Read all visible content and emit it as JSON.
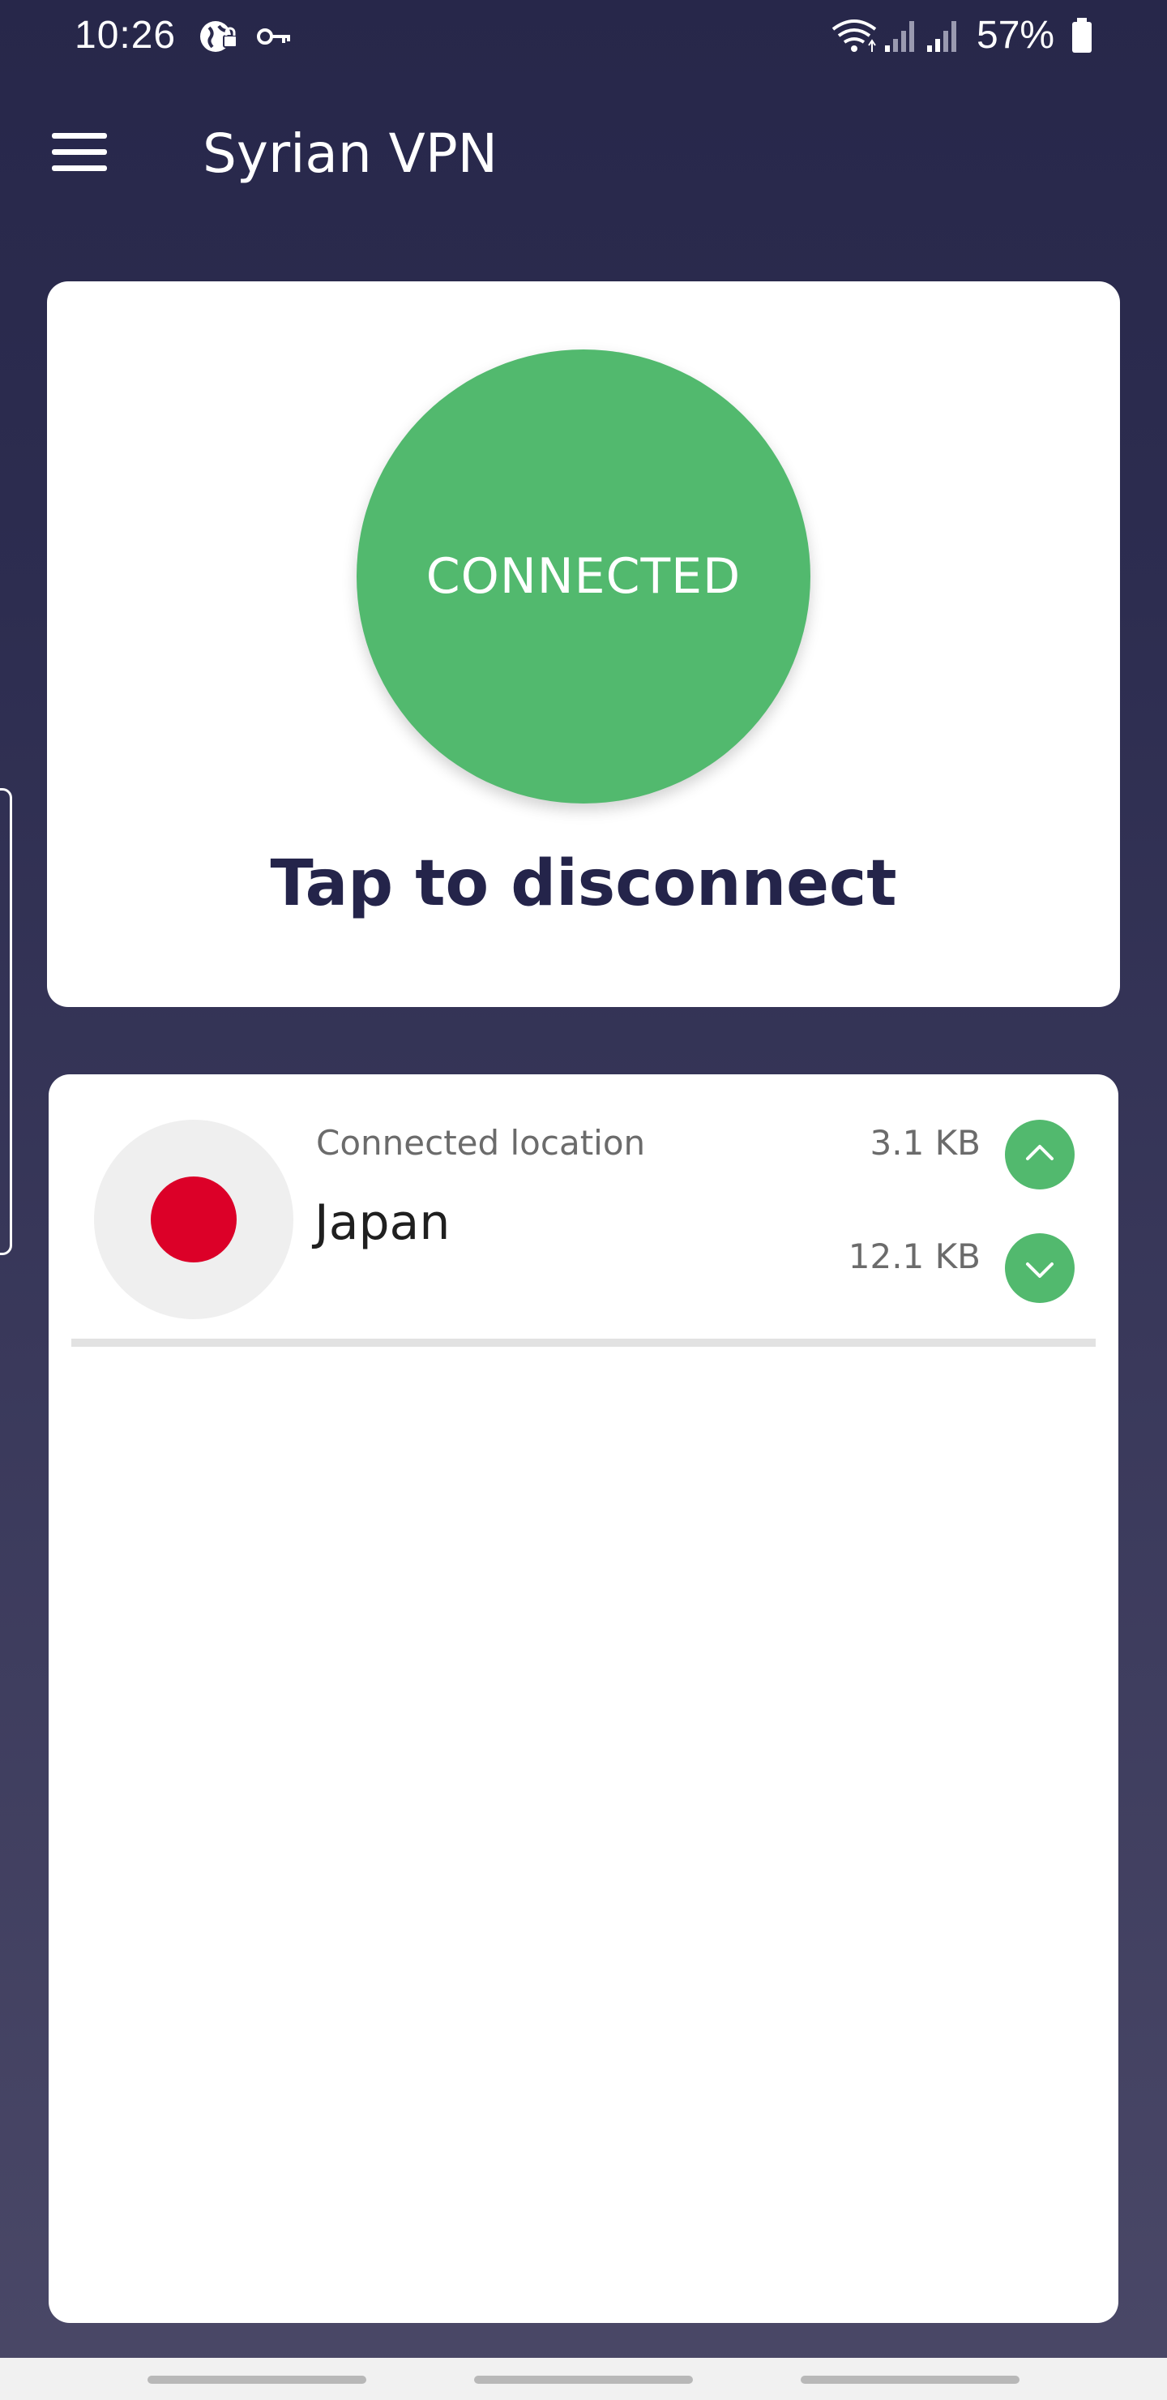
{
  "status_bar": {
    "time": "10:26",
    "battery_percent": "57%",
    "icons": [
      "vpn-globe-icon",
      "key-icon",
      "wifi-icon",
      "signal-icon",
      "signal-icon",
      "battery-icon"
    ]
  },
  "app_bar": {
    "title": "Syrian VPN",
    "menu_icon": "hamburger-menu-icon"
  },
  "connection": {
    "status": "CONNECTED",
    "action_label": "Tap to disconnect",
    "color": "#52b96e"
  },
  "location": {
    "label": "Connected location",
    "country": "Japan",
    "flag_icon": "japan-flag-icon",
    "upload": "3.1 KB",
    "download": "12.1 KB",
    "upload_icon": "chevron-up-icon",
    "download_icon": "chevron-down-icon"
  },
  "colors": {
    "accent": "#52b96e",
    "background_top": "#27274a",
    "title_text": "#24244a",
    "flag_red": "#dc0028"
  }
}
